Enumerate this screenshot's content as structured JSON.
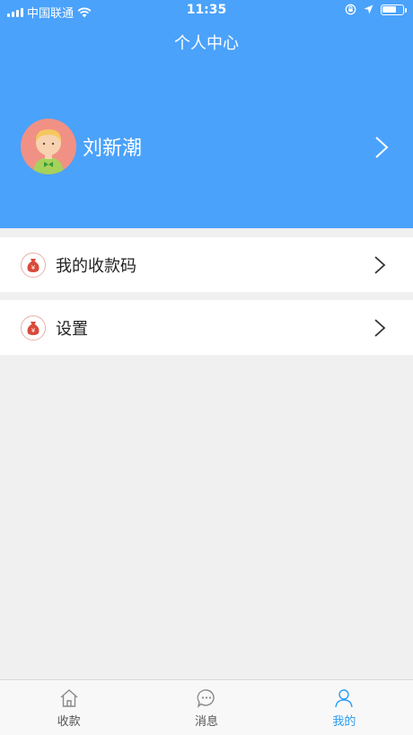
{
  "status_bar": {
    "carrier": "中国联通",
    "time": "11:35",
    "battery_level": 0.7
  },
  "header": {
    "title": "个人中心",
    "background_color": "#4aa2fb"
  },
  "profile": {
    "username": "刘新潮"
  },
  "menu": [
    {
      "label": "我的收款码",
      "icon": "money-bag-icon"
    },
    {
      "label": "设置",
      "icon": "money-bag-icon"
    }
  ],
  "tab_bar": {
    "active_color": "#2a9df4",
    "tabs": [
      {
        "label": "收款",
        "icon": "home-icon",
        "active": false
      },
      {
        "label": "消息",
        "icon": "chat-bubble-icon",
        "active": false
      },
      {
        "label": "我的",
        "icon": "user-icon",
        "active": true
      }
    ]
  }
}
